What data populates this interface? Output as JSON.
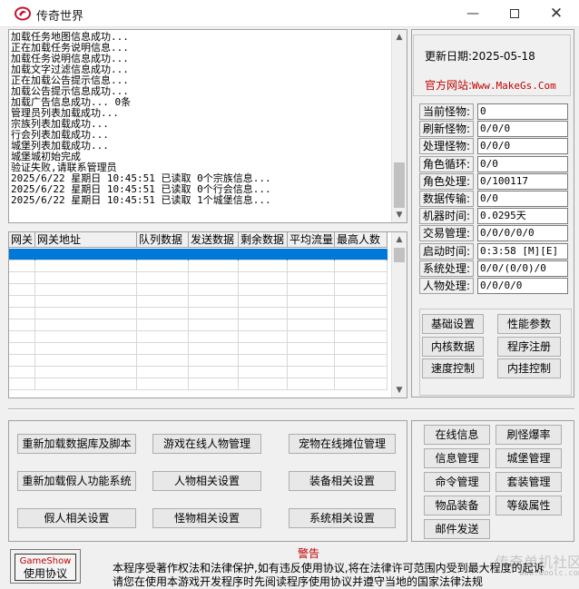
{
  "window": {
    "title": "传奇世界"
  },
  "log": {
    "lines": [
      "加载任务地图信息成功...",
      "正在加载任务说明信息...",
      "加载任务说明信息成功...",
      "加载文字过滤信息成功...",
      "正在加载公告提示信息...",
      "加载公告提示信息成功...",
      "加载广告信息成功... 0条",
      "管理员列表加载成功...",
      "宗族列表加载成功...",
      "行会列表加载成功...",
      "城堡列表加载成功...",
      "城堡城初始完成",
      "验证失败,请联系管理员",
      "2025/6/22 星期日 10:45:51 已读取 0个宗族信息...",
      "2025/6/22 星期日 10:45:51 已读取 0个行会信息...",
      "2025/6/22 星期日 10:45:51 已读取 1个城堡信息..."
    ]
  },
  "grid": {
    "columns": [
      "网关",
      "网关地址",
      "队列数据",
      "发送数据",
      "剩余数据",
      "平均流量",
      "最高人数"
    ]
  },
  "info": {
    "update_date": "更新日期:2025-05-18",
    "site_label": "官方网站:",
    "site_url": "Www.MakeGs.Com"
  },
  "stats": [
    {
      "label": "当前怪物:",
      "value": "0"
    },
    {
      "label": "刷新怪物:",
      "value": "0/0/0"
    },
    {
      "label": "处理怪物:",
      "value": "0/0/0"
    },
    {
      "label": "角色循环:",
      "value": "0/0"
    },
    {
      "label": "角色处理:",
      "value": "0/100117"
    },
    {
      "label": "数据传输:",
      "value": "0/0"
    },
    {
      "label": "机器时间:",
      "value": "0.0295天"
    },
    {
      "label": "交易管理:",
      "value": "0/0/0/0/0"
    },
    {
      "label": "启动时间:",
      "value": "0:3:58 [M][E]"
    },
    {
      "label": "系统处理:",
      "value": "0/0/(0/0)/0"
    },
    {
      "label": "人物处理:",
      "value": "0/0/0/0"
    }
  ],
  "func_buttons": {
    "basic_settings": "基础设置",
    "perf_params": "性能参数",
    "kernel_data": "内核数据",
    "program_register": "程序注册",
    "speed_control": "速度控制",
    "anti_cheat": "内挂控制"
  },
  "main_buttons": {
    "reload_db": "重新加载数据库及脚本",
    "online_players": "游戏在线人物管理",
    "pet_stalls": "宠物在线摊位管理",
    "reload_bots": "重新加载假人功能系统",
    "character_settings": "人物相关设置",
    "equipment_settings": "装备相关设置",
    "bot_settings": "假人相关设置",
    "monster_settings": "怪物相关设置",
    "system_settings": "系统相关设置"
  },
  "side_buttons": {
    "online_info": "在线信息",
    "drop_rate": "刷怪爆率",
    "info_mgmt": "信息管理",
    "castle_mgmt": "城堡管理",
    "command_mgmt": "命令管理",
    "set_mgmt": "套装管理",
    "item_equip": "物品装备",
    "level_attr": "等级属性",
    "mail_send": "邮件发送"
  },
  "agreement": {
    "brand": "GameShow",
    "button": "使用协议"
  },
  "warning": {
    "title": "警告",
    "line1": "本程序受著作权法和法律保护,如有违反使用协议,将在法律许可范围内受到最大程度的起诉",
    "line2": "请您在使用本游戏开发程序时先阅读程序使用协议并遵守当地的国家法律法规"
  },
  "watermark": {
    "text": "传奇单机社区",
    "url": "www.woolc.com"
  },
  "colors": {
    "selection": "#0078d7",
    "accent_red": "#c00000"
  }
}
